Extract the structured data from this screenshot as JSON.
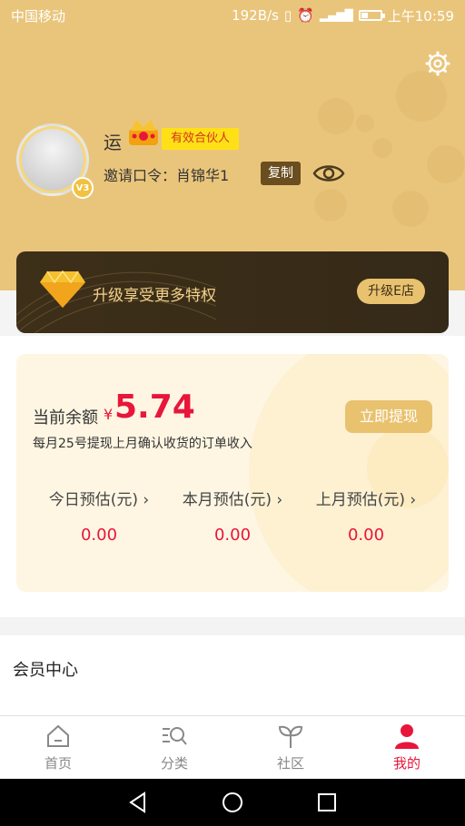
{
  "status_bar": {
    "carrier": "中国移动",
    "speed": "192B/s",
    "time": "上午10:59"
  },
  "profile": {
    "nickname": "运",
    "partner_tag": "有效合伙人",
    "level_badge": "V3",
    "invite_text": "邀请口令：肖锦华1",
    "copy_label": "复制"
  },
  "upgrade": {
    "text": "升级享受更多特权",
    "button": "升级E店"
  },
  "balance": {
    "label": "当前余额",
    "currency": "¥",
    "value": "5.74",
    "note": "每月25号提现上月确认收货的订单收入",
    "withdraw_button": "立即提现"
  },
  "stats": [
    {
      "label": "今日预估(元) ›",
      "value": "0.00"
    },
    {
      "label": "本月预估(元) ›",
      "value": "0.00"
    },
    {
      "label": "上月预估(元) ›",
      "value": "0.00"
    }
  ],
  "member_center": {
    "title": "会员中心"
  },
  "tabs": [
    {
      "label": "首页"
    },
    {
      "label": "分类"
    },
    {
      "label": "社区"
    },
    {
      "label": "我的"
    }
  ],
  "colors": {
    "header": "#e9c57c",
    "accent_red": "#e8163b",
    "gold_button": "#e9c26f",
    "dark_banner": "#3d2f18"
  }
}
